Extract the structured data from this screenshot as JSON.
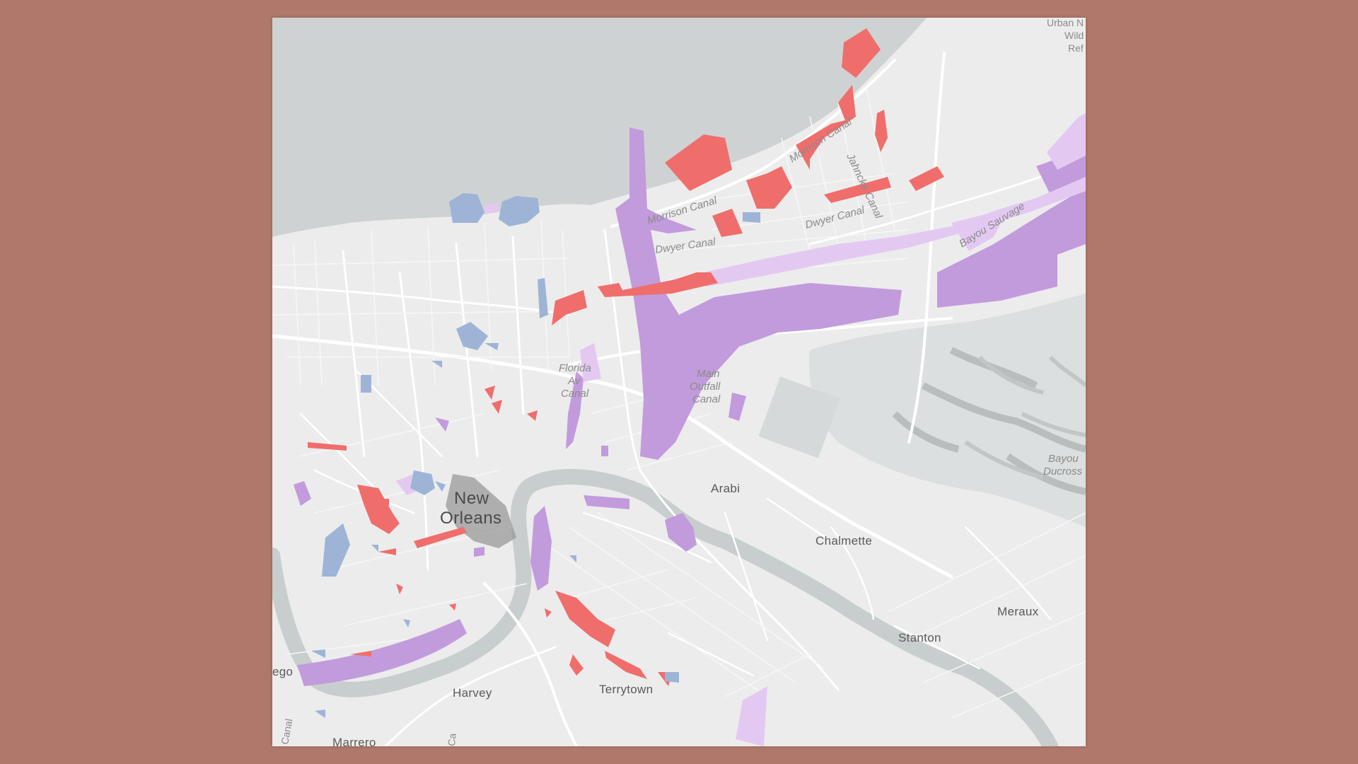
{
  "map": {
    "colors": {
      "background": "#b0786b",
      "land": "#ececec",
      "lake": "#cfd2d3",
      "river": "#c8cecd",
      "marsh": "#d9dcdc",
      "red_zone": "#ef6e6c",
      "purple_zone": "#c29bdc",
      "light_purple_zone": "#e3c9f2",
      "blue_zone": "#9db4d6",
      "downtown": "#9a9a9a"
    },
    "labels": {
      "new_orleans_line1": "New",
      "new_orleans_line2": "Orleans",
      "arabi": "Arabi",
      "chalmette": "Chalmette",
      "meraux": "Meraux",
      "stanton": "Stanton",
      "harvey": "Harvey",
      "terrytown": "Terrytown",
      "marrero": "Marrero",
      "gretna_fragment": "ego",
      "morrison_canal_1": "Morrison Canal",
      "morrison_canal_2": "Morrison Canal",
      "dwyer_canal_1": "Dwyer Canal",
      "dwyer_canal_2": "Dwyer Canal",
      "jahncke_canal": "Jahncke Canal",
      "bayou_sauvage": "Bayou Sauvage",
      "florida_canal_1": "Florida",
      "florida_canal_2": "Av",
      "florida_canal_3": "Canal",
      "main_outfall_1": "Main",
      "main_outfall_2": "Outfall",
      "main_outfall_3": "Canal",
      "bayou_ducross_1": "Bayou",
      "bayou_ducross_2": "Ducross",
      "urban_wildlife_1": "Urban N",
      "urban_wildlife_2": "Wild",
      "urban_wildlife_3": "Ref",
      "canal_fragment_1": "Canal",
      "canal_fragment_2": "Ca"
    }
  }
}
